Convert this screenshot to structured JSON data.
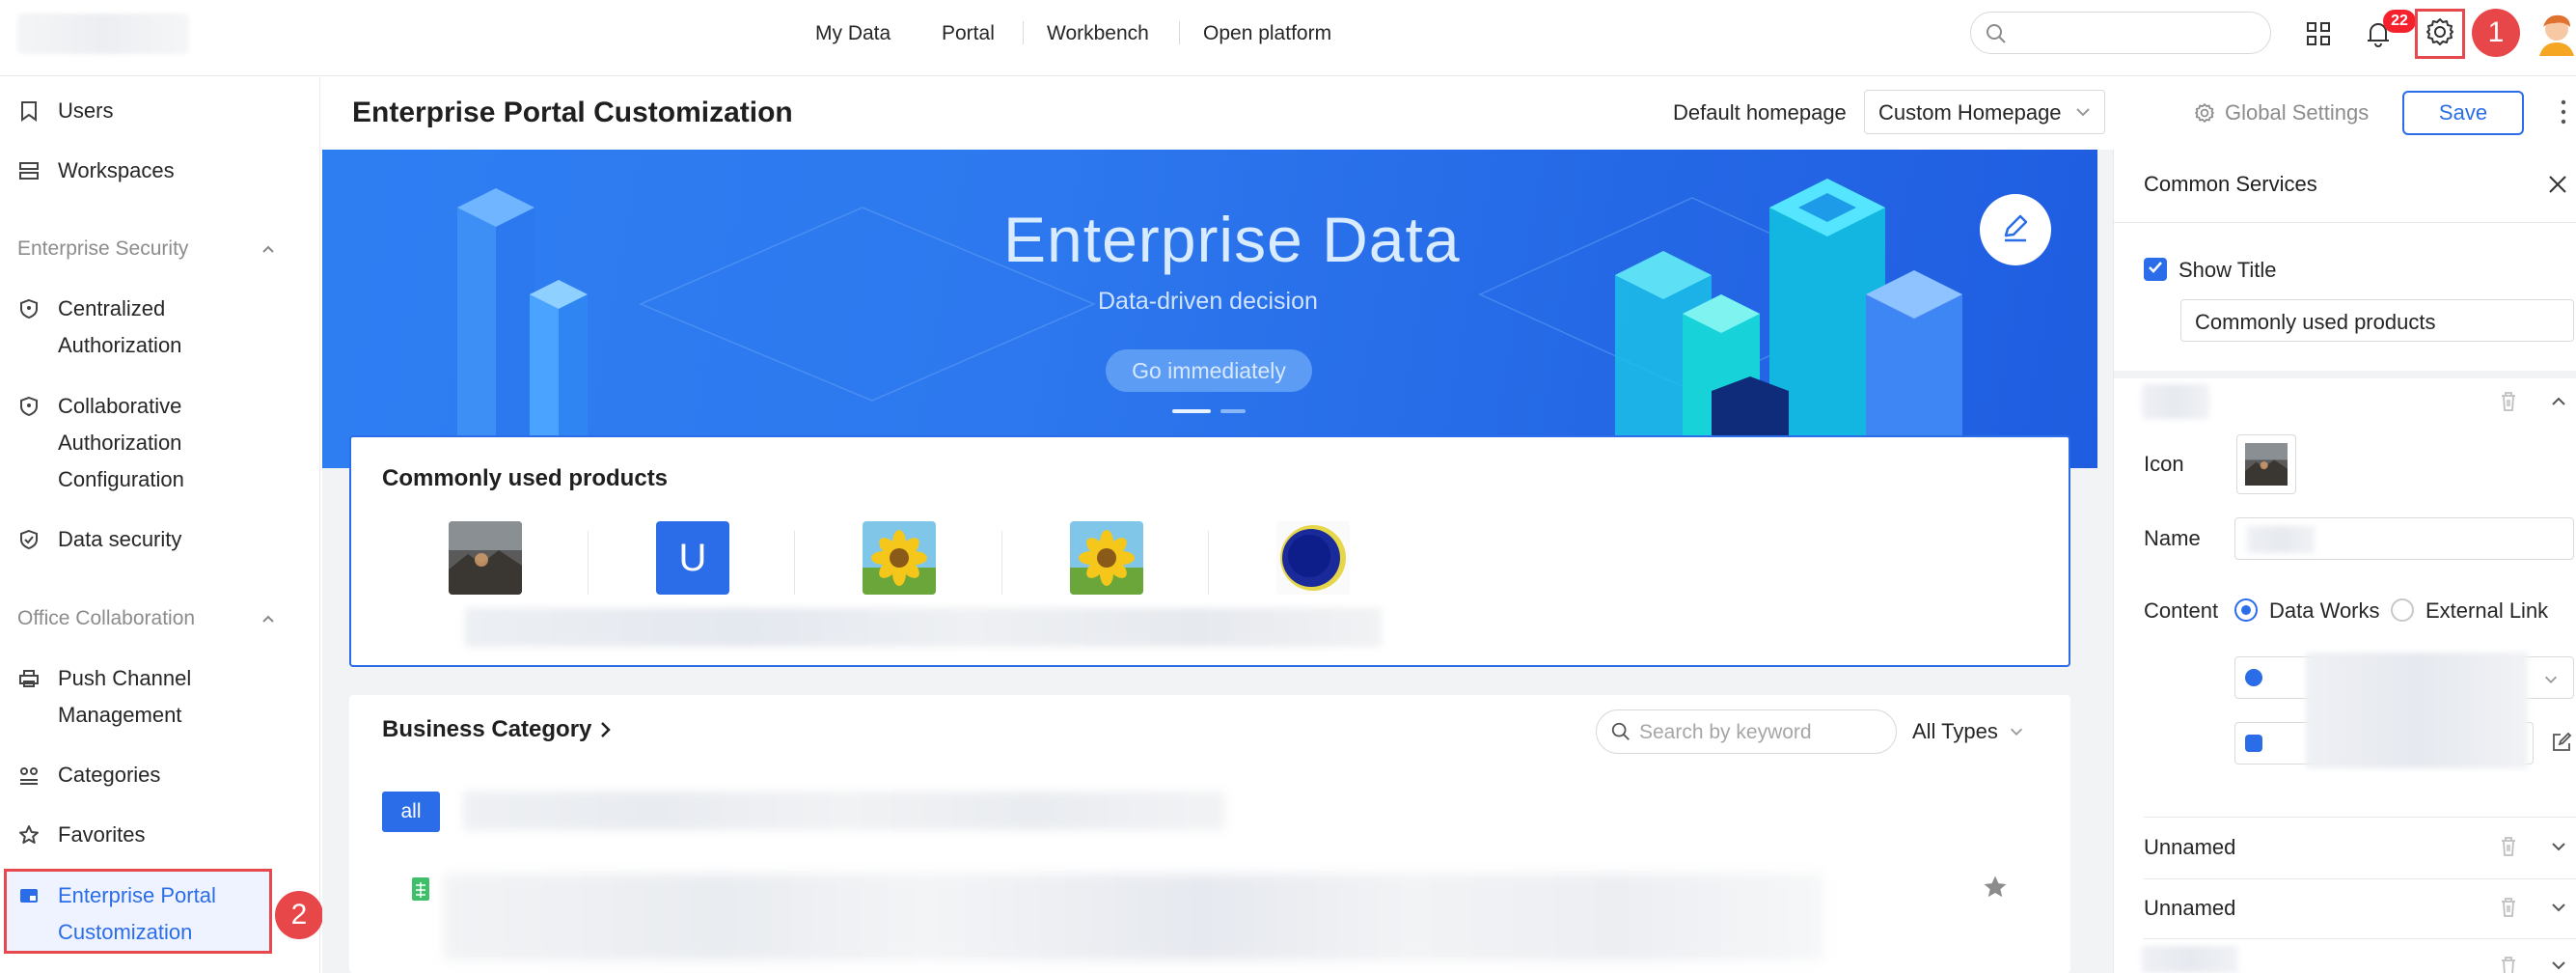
{
  "topnav": {
    "items": [
      "My Data",
      "Portal",
      "Workbench",
      "Open platform"
    ],
    "notification_count": "22",
    "step_1": "1"
  },
  "sidebar": {
    "items_top": [
      {
        "label": "Users",
        "icon": "bookmark-icon"
      },
      {
        "label": "Workspaces",
        "icon": "layers-icon"
      }
    ],
    "enterprise_security": {
      "heading": "Enterprise Security",
      "items": [
        {
          "lines": [
            "Centralized",
            "Authorization"
          ],
          "icon": "shield-icon"
        },
        {
          "lines": [
            "Collaborative",
            "Authorization",
            "Configuration"
          ],
          "icon": "shield-icon"
        },
        {
          "lines": [
            "Data security"
          ],
          "icon": "shield-check-icon"
        }
      ]
    },
    "office_collaboration": {
      "heading": "Office Collaboration",
      "items": [
        {
          "lines": [
            "Push Channel",
            "Management"
          ],
          "icon": "printer-icon"
        },
        {
          "lines": [
            "Categories"
          ],
          "icon": "categories-icon"
        },
        {
          "lines": [
            "Favorites"
          ],
          "icon": "star-icon"
        },
        {
          "lines": [
            "Enterprise Portal",
            "Customization"
          ],
          "icon": "portal-icon"
        }
      ]
    },
    "step_2": "2"
  },
  "header": {
    "title": "Enterprise Portal Customization",
    "default_homepage_label": "Default homepage",
    "default_homepage_value": "Custom Homepage",
    "global_settings": "Global Settings",
    "save": "Save"
  },
  "banner": {
    "title": "Enterprise Data",
    "subtitle": "Data-driven decision",
    "button": "Go immediately"
  },
  "common_products": {
    "title": "Commonly used products",
    "items": [
      {
        "icon": "photo-dark-icon"
      },
      {
        "icon": "letter-u-icon",
        "letter": "U"
      },
      {
        "icon": "sunflower-icon"
      },
      {
        "icon": "sunflower-icon"
      },
      {
        "icon": "blue-circle-icon"
      }
    ]
  },
  "business_category": {
    "title": "Business Category",
    "search_placeholder": "Search by keyword",
    "type_filter": "All Types",
    "all_tab": "all"
  },
  "right_panel": {
    "title": "Common Services",
    "show_title_label": "Show Title",
    "title_value": "Commonly used products",
    "icon_label": "Icon",
    "name_label": "Name",
    "content_label": "Content",
    "content_options": [
      "Data Works",
      "External Link"
    ],
    "collapsed_items": [
      "Unnamed",
      "Unnamed"
    ]
  },
  "colors": {
    "accent": "#2b6de8",
    "highlight_red": "#e5484d",
    "banner_blue": "#2a74ec"
  }
}
